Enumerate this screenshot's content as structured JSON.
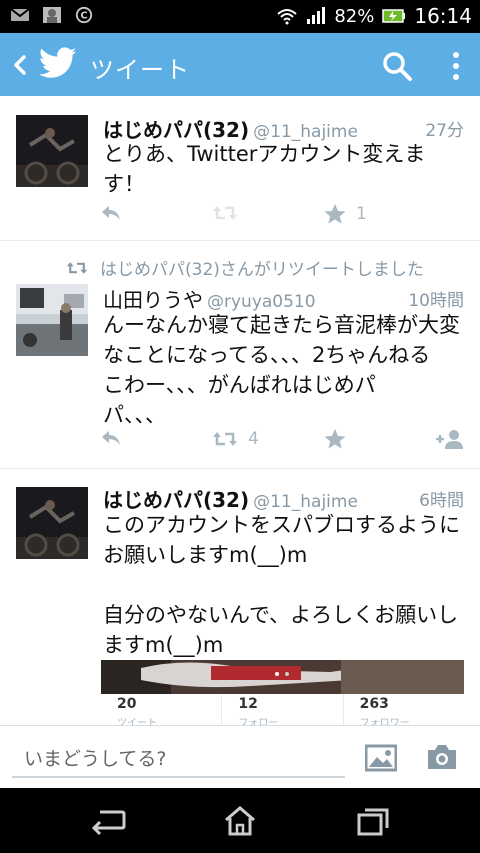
{
  "status_bar": {
    "battery": "82%",
    "time": "16:14",
    "icons": [
      "gmail-icon",
      "photo-notification-icon",
      "c-app-icon",
      "wifi-icon",
      "signal-icon",
      "battery-icon"
    ]
  },
  "action_bar": {
    "title": "ツイート",
    "icons": [
      "back-chevron-icon",
      "twitter-bird-icon",
      "search-icon",
      "overflow-menu-icon"
    ],
    "accent_color": "#5eaee6"
  },
  "tweets": [
    {
      "name": "はじめパパ(32)",
      "handle": "@11_hajime",
      "time": "27分",
      "text": "とりあ、Twitterアカウント変えま\nす！",
      "favorites": "1"
    },
    {
      "retweet_note": "はじめパパ(32)さんがリツイートしました",
      "name": "山田りうや",
      "handle": "@ryuya0510",
      "time": "10時間",
      "text": "んーなんか寝て起きたら音泥棒が大変\nなことになってる、、、2ちゃんねる\nこわー、、、がんばれはじめパ\nパ、、、",
      "retweets": "4"
    },
    {
      "name": "はじめパパ(32)",
      "handle": "@11_hajime",
      "time": "6時間",
      "text": "このアカウントをスパブロするように\nお願いしますm(__)m\n\n自分のやないんで、よろしくお願いし\nますm(__)m",
      "stats": [
        {
          "value": "20",
          "label": "ツイート"
        },
        {
          "value": "12",
          "label": "フォロー"
        },
        {
          "value": "263",
          "label": "フォロワー"
        }
      ]
    }
  ],
  "compose": {
    "placeholder": "いまどうしてる?"
  }
}
